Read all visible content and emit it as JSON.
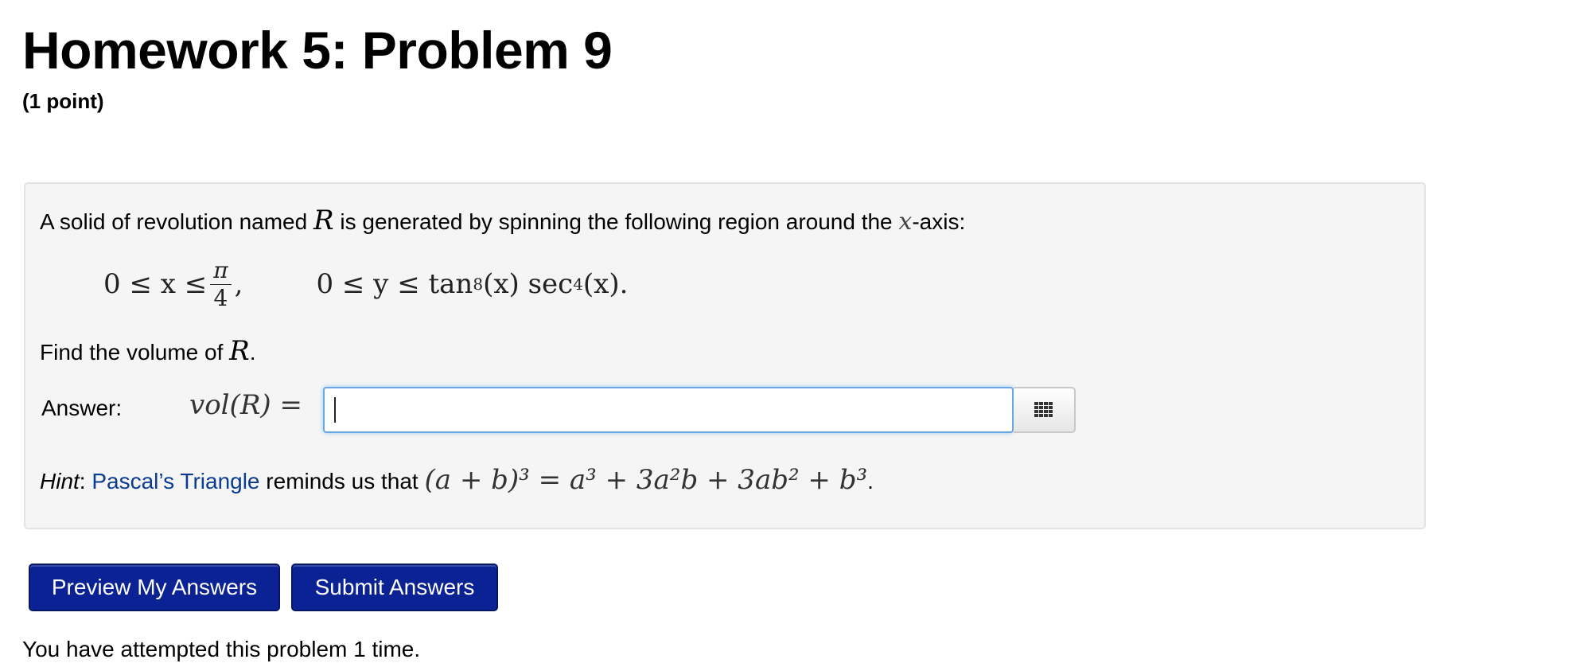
{
  "header": {
    "title": "Homework 5: Problem 9",
    "points": "(1 point)"
  },
  "problem": {
    "intro_before": "A solid of revolution named ",
    "solid_symbol": "R",
    "intro_middle": " is generated by spinning the following region around the ",
    "axis_symbol": "x",
    "intro_after": "-axis:",
    "region": {
      "x_range_prefix": "0 ≤ x ≤ ",
      "pi": "π",
      "four": "4",
      "comma": ",",
      "y_range": "0 ≤ y ≤ tan",
      "tan_power": "8",
      "arg1": "(x) sec",
      "sec_power": "4",
      "arg2": "(x)."
    },
    "find_text": "Find the volume of ",
    "find_symbol": "R",
    "find_end": "."
  },
  "answer": {
    "label": "Answer:",
    "lhs": "vol(R) =",
    "value": "",
    "palette_icon": "grid-icon"
  },
  "hint": {
    "label": "Hint",
    "colon": ": ",
    "link_text": "Pascal’s Triangle",
    "text": " reminds us that ",
    "formula": "(a + b)³ = a³ + 3a²b + 3ab² + b³",
    "end": "."
  },
  "buttons": {
    "preview": "Preview My Answers",
    "submit": "Submit Answers"
  },
  "status": {
    "attempts": "You have attempted this problem 1 time."
  },
  "colors": {
    "button_bg": "#0b2294",
    "link": "#0a3c91",
    "input_focus": "#6aa5e6",
    "panel_bg": "#f5f5f5"
  }
}
